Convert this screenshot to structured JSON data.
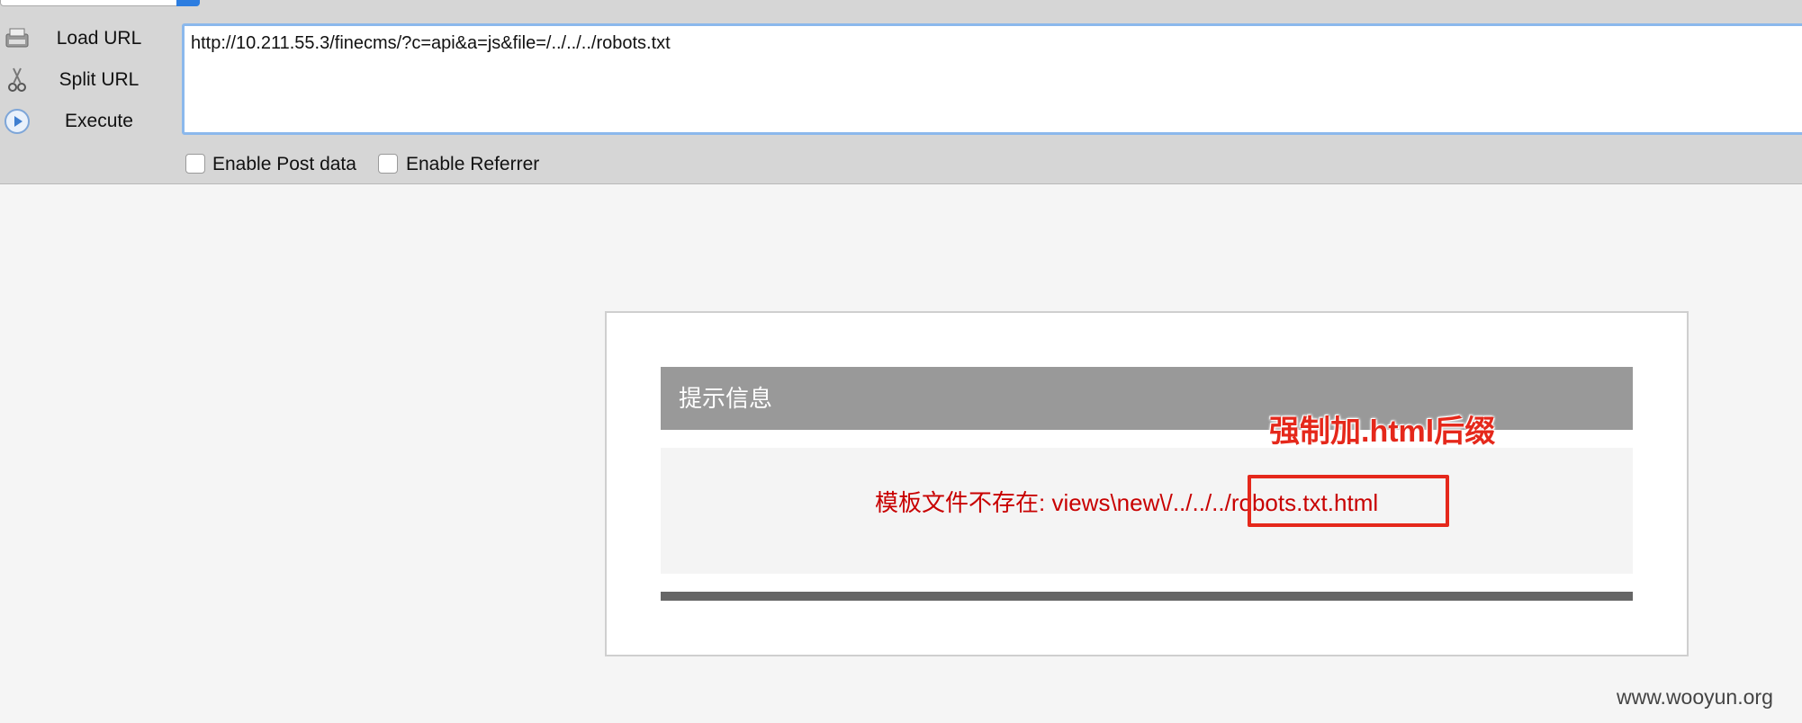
{
  "toolbar": {
    "commands": [
      {
        "label": "Load URL",
        "icon": "load-url-icon"
      },
      {
        "label": "Split URL",
        "icon": "split-url-icon"
      },
      {
        "label": "Execute",
        "icon": "execute-icon"
      }
    ],
    "url_value": "http://10.211.55.3/finecms/?c=api&a=js&file=/../../../robots.txt",
    "enable_post_label": "Enable Post data",
    "enable_referrer_label": "Enable Referrer",
    "enable_post_checked": false,
    "enable_referrer_checked": false
  },
  "panel": {
    "title": "提示信息",
    "message_prefix": "模板文件不存在: views\\new\\/../../..",
    "message_highlight": "/robots.txt.html",
    "annotation": "强制加.html后缀"
  },
  "watermark": "www.wooyun.org",
  "colors": {
    "toolbar_bg": "#d6d6d6",
    "url_border": "#8bb8ec",
    "header_bg": "#999999",
    "message_text": "#c80000",
    "annotation": "#e5281b"
  }
}
